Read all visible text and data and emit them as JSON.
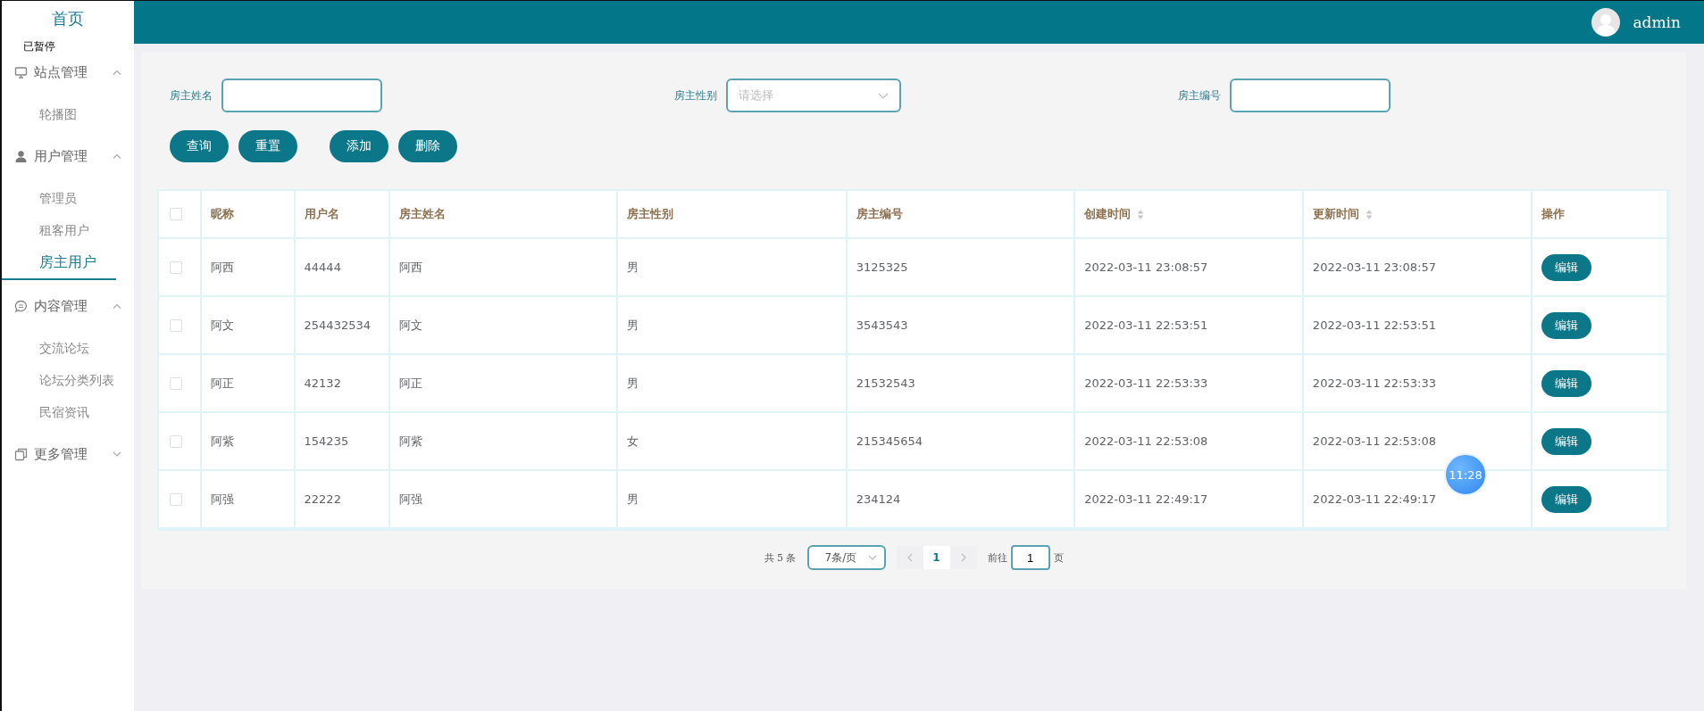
{
  "sidebar": {
    "home": "首页",
    "groups": [
      {
        "title": "站点管理",
        "expanded": true,
        "items": [
          {
            "label": "轮播图",
            "selected": false
          }
        ]
      },
      {
        "title": "用户管理",
        "expanded": true,
        "items": [
          {
            "label": "管理员",
            "selected": false
          },
          {
            "label": "租客用户",
            "selected": false
          },
          {
            "label": "房主用户",
            "selected": true
          }
        ]
      },
      {
        "title": "内容管理",
        "expanded": true,
        "items": [
          {
            "label": "交流论坛",
            "selected": false
          },
          {
            "label": "论坛分类列表",
            "selected": false
          },
          {
            "label": "民宿资讯",
            "selected": false
          }
        ]
      },
      {
        "title": "更多管理",
        "expanded": false
      }
    ]
  },
  "header": {
    "user": "admin"
  },
  "search": {
    "fields": [
      {
        "label": "房主姓名",
        "kind": "text"
      },
      {
        "label": "房主性别",
        "kind": "select",
        "placeholder": "请选择"
      },
      {
        "label": "房主编号",
        "kind": "text"
      }
    ],
    "query_buttons": [
      "查询",
      "重置"
    ],
    "action_buttons": [
      "添加",
      "删除"
    ]
  },
  "table": {
    "all_checked": false,
    "columns": [
      {
        "label": "昵称",
        "sortable": false
      },
      {
        "label": "用户名",
        "sortable": false
      },
      {
        "label": "房主姓名",
        "sortable": false
      },
      {
        "label": "房主性别",
        "sortable": false
      },
      {
        "label": "房主编号",
        "sortable": false
      },
      {
        "label": "创建时间",
        "sortable": true
      },
      {
        "label": "更新时间",
        "sortable": true
      },
      {
        "label": "操作",
        "sortable": false
      }
    ],
    "rows": [
      {
        "checked": false,
        "cells": [
          "阿西",
          "44444",
          "阿西",
          "男",
          "3125325",
          "2022-03-11 23:08:57",
          "2022-03-11 23:08:57"
        ],
        "action": "编辑"
      },
      {
        "checked": false,
        "cells": [
          "阿文",
          "254432534",
          "阿文",
          "男",
          "3543543",
          "2022-03-11 22:53:51",
          "2022-03-11 22:53:51"
        ],
        "action": "编辑"
      },
      {
        "checked": false,
        "cells": [
          "阿正",
          "42132",
          "阿正",
          "男",
          "21532543",
          "2022-03-11 22:53:33",
          "2022-03-11 22:53:33"
        ],
        "action": "编辑"
      },
      {
        "checked": false,
        "cells": [
          "阿紫",
          "154235",
          "阿紫",
          "女",
          "215345654",
          "2022-03-11 22:53:08",
          "2022-03-11 22:53:08"
        ],
        "action": "编辑"
      },
      {
        "checked": false,
        "cells": [
          "阿强",
          "22222",
          "阿强",
          "男",
          "234124",
          "2022-03-11 22:49:17",
          "2022-03-11 22:49:17"
        ],
        "action": "编辑"
      }
    ]
  },
  "pagination": {
    "total": "共 5 条",
    "page_size": "7条/页",
    "pages": [
      {
        "label": "1",
        "selected": true
      }
    ],
    "goto_label": "前往",
    "goto_value": "1",
    "goto_suffix": "页"
  },
  "overlays": {
    "recorder_status": "已暂停",
    "clock": "11:28"
  }
}
